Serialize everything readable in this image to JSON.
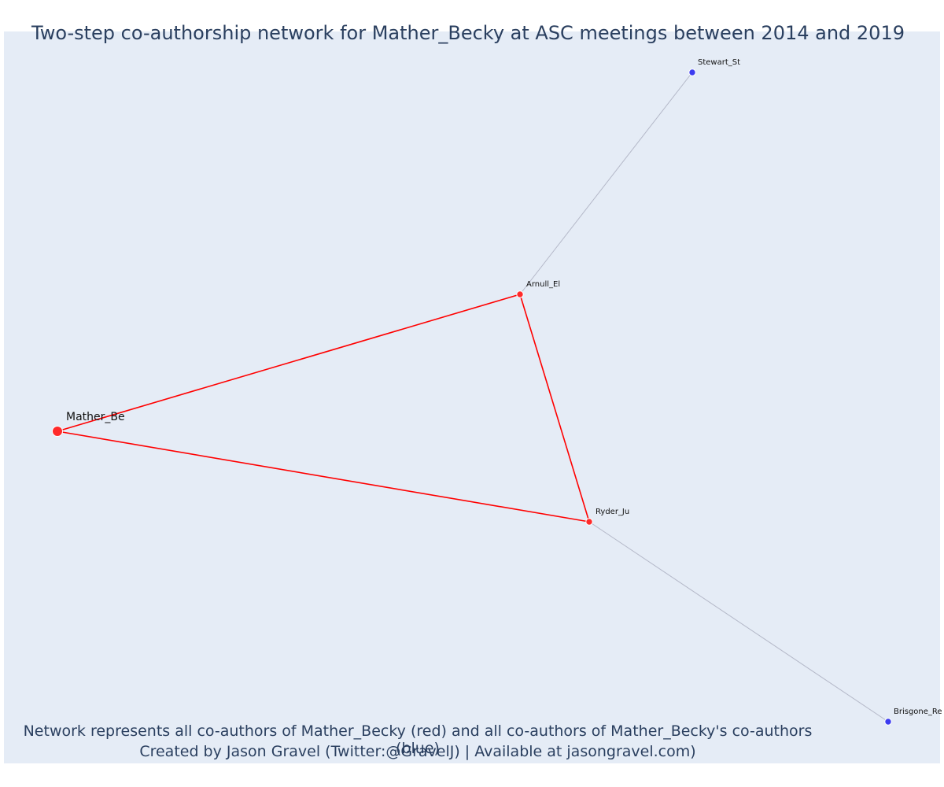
{
  "title": "Two-step co-authorship network for Mather_Becky at ASC meetings between 2014 and 2019",
  "caption_line1": "Network represents all co-authors of Mather_Becky (red) and all co-authors of Mather_Becky's co-authors (blue)",
  "caption_line2": "Created by Jason Gravel (Twitter:@GravelJ) | Available at jasongravel.com)",
  "colors": {
    "background": "#e5ecf6",
    "primary": "#ff2a2a",
    "secondary": "#3c3cf0",
    "edge_primary": "#ff0000",
    "edge_secondary": "#b4b8c8",
    "text": "#2a3f5f"
  },
  "network": {
    "nodes": [
      {
        "id": "mather",
        "label": "Mather_Be",
        "group": "focal"
      },
      {
        "id": "arnull",
        "label": "Arnull_El",
        "group": "coauthor"
      },
      {
        "id": "ryder",
        "label": "Ryder_Ju",
        "group": "coauthor"
      },
      {
        "id": "stewart",
        "label": "Stewart_St",
        "group": "second"
      },
      {
        "id": "brisgone",
        "label": "Brisgone_Re",
        "group": "second"
      }
    ],
    "edges": [
      {
        "source": "mather",
        "target": "arnull",
        "type": "primary"
      },
      {
        "source": "mather",
        "target": "ryder",
        "type": "primary"
      },
      {
        "source": "arnull",
        "target": "ryder",
        "type": "primary"
      },
      {
        "source": "arnull",
        "target": "stewart",
        "type": "secondary"
      },
      {
        "source": "ryder",
        "target": "brisgone",
        "type": "secondary"
      }
    ]
  }
}
